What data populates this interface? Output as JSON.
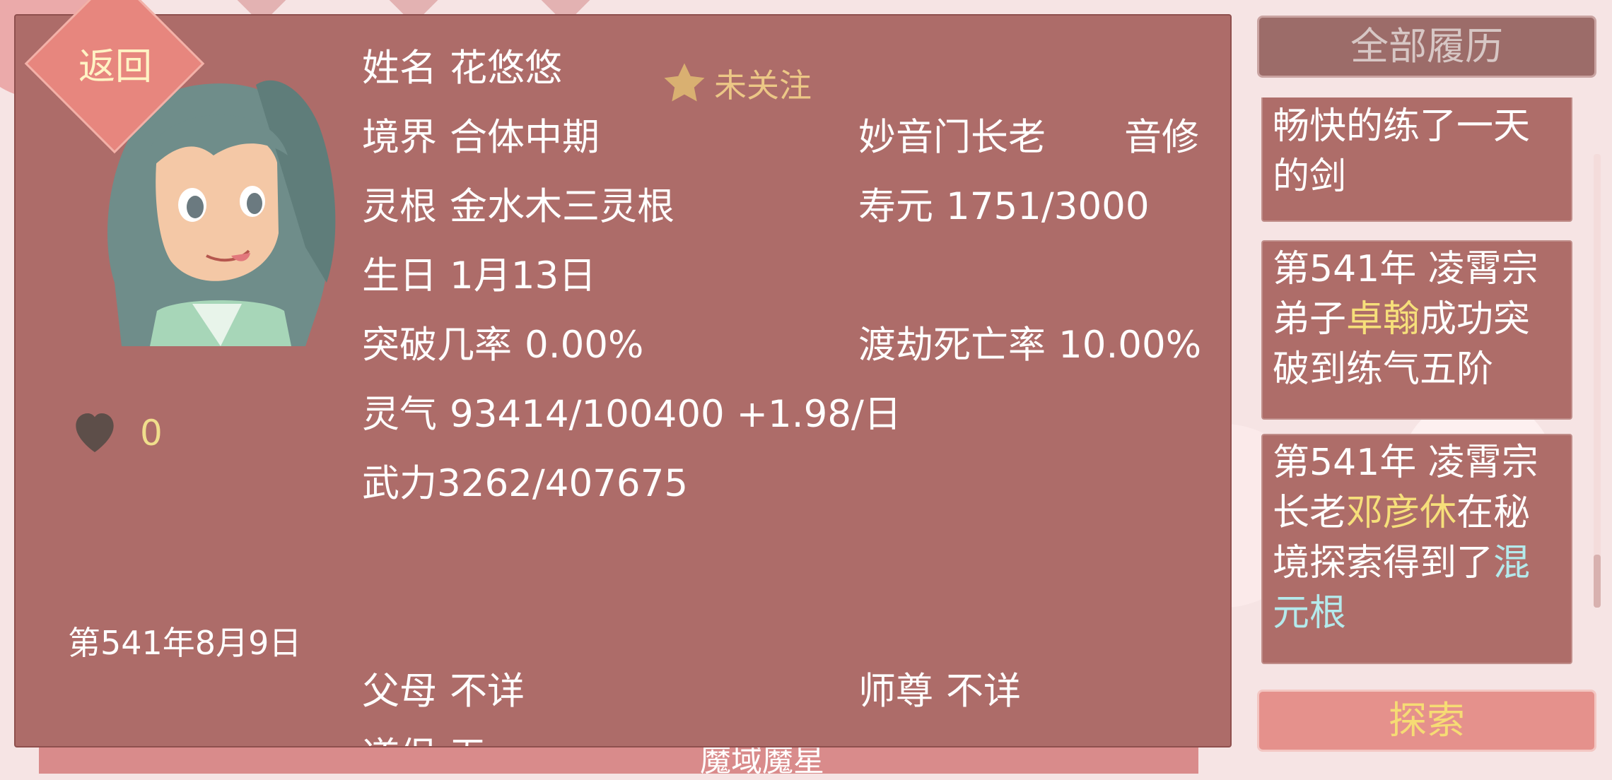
{
  "profile": {
    "back_label": "返回",
    "follow_label": "未关注",
    "name_label": "姓名",
    "name_value": "花悠悠",
    "realm_label": "境界",
    "realm_value": "合体中期",
    "sect_role": "妙音门长老",
    "cultivation_type": "音修",
    "root_label": "灵根",
    "root_value": "金水木三灵根",
    "lifespan_label": "寿元",
    "lifespan_value": "1751/3000",
    "birthday_label": "生日",
    "birthday_value": "1月13日",
    "breakthrough_label": "突破几率",
    "breakthrough_value": "0.00%",
    "tribulation_label": "渡劫死亡率",
    "tribulation_value": "10.00%",
    "qi_label": "灵气",
    "qi_value": "93414/100400 +1.98/日",
    "force_text": "武力3262/407675",
    "parents_label": "父母",
    "parents_value": "不详",
    "master_label": "师尊",
    "master_value": "不详",
    "dao_partial": "道侣 无",
    "favor_count": "0",
    "current_date": "第541年8月9日"
  },
  "sidebar": {
    "history_button": "全部履历",
    "explore_button": "探索",
    "log": [
      {
        "text": "畅快的练了一天的剑"
      },
      {
        "pre": "第541年 凌霄宗弟子",
        "name": "卓翰",
        "post": "成功突破到练气五阶"
      },
      {
        "pre": "第541年 凌霄宗长老",
        "name": "邓彦休",
        "mid": "在秘境探索得到了",
        "item": "混元根"
      }
    ]
  },
  "background": {
    "peek_text": "魔域魔星"
  },
  "colors": {
    "panel": "#ad6c69",
    "highlight_name": "#f6df7a",
    "highlight_item": "#b4eaec",
    "accent_gold": "#f0de8c"
  }
}
